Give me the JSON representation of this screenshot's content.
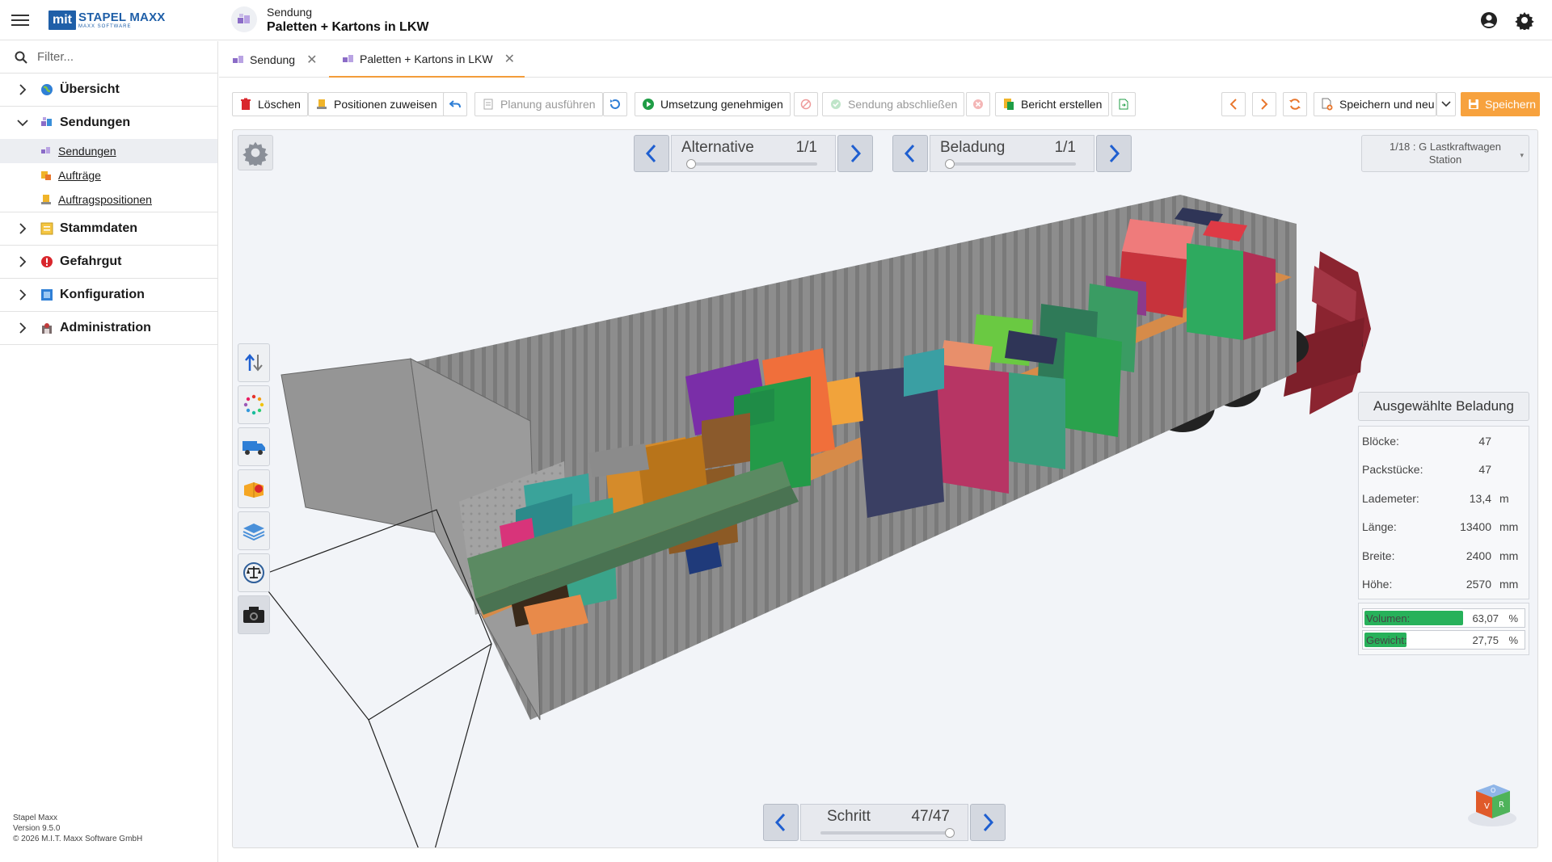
{
  "app": {
    "logo_mark": "mit",
    "logo_name": "STAPEL MAXX",
    "logo_sub": "MAXX SOFTWARE"
  },
  "header": {
    "subtitle": "Sendung",
    "title": "Paletten + Kartons in LKW",
    "icons": [
      "hamburger-icon",
      "account-icon",
      "settings-icon"
    ]
  },
  "sidebar": {
    "filter_placeholder": "Filter...",
    "items": [
      {
        "label": "Übersicht",
        "icon": "globe-icon"
      },
      {
        "label": "Sendungen",
        "icon": "shipment-icon",
        "expanded": true,
        "children": [
          {
            "label": "Sendungen",
            "icon": "shipment-icon",
            "active": true
          },
          {
            "label": "Aufträge",
            "icon": "orders-icon"
          },
          {
            "label": "Auftragspositionen",
            "icon": "order-positions-icon"
          }
        ]
      },
      {
        "label": "Stammdaten",
        "icon": "master-data-icon"
      },
      {
        "label": "Gefahrgut",
        "icon": "hazard-icon"
      },
      {
        "label": "Konfiguration",
        "icon": "config-icon"
      },
      {
        "label": "Administration",
        "icon": "admin-icon"
      }
    ],
    "footer": {
      "line1": "Stapel Maxx",
      "line2": "Version 9.5.0",
      "line3": "© 2026 M.I.T. Maxx Software GmbH"
    }
  },
  "tabs": [
    {
      "label": "Sendung",
      "active": false
    },
    {
      "label": "Paletten + Kartons in LKW",
      "active": true
    }
  ],
  "toolbar": {
    "delete": "Löschen",
    "assign_positions": "Positionen zuweisen",
    "run_planning": "Planung ausführen",
    "approve": "Umsetzung genehmigen",
    "close_shipment": "Sendung abschließen",
    "create_report": "Bericht erstellen",
    "save_and_new": "Speichern und neu",
    "save": "Speichern"
  },
  "viewer": {
    "alternative": {
      "label": "Alternative",
      "value": "1/1",
      "progress": 0.0
    },
    "loading": {
      "label": "Beladung",
      "value": "1/1",
      "progress": 0.0
    },
    "vehicle": {
      "line1": "1/18 : G Lastkraftwagen",
      "line2": "Station"
    },
    "step": {
      "label": "Schritt",
      "value": "47/47",
      "progress": 1.0
    },
    "side_tools": [
      "sort-arrows-icon",
      "color-dots-icon",
      "truck-icon",
      "box-icon",
      "pallet-layers-icon",
      "scale-icon",
      "camera-icon"
    ]
  },
  "selected_loading": {
    "title": "Ausgewählte Beladung",
    "rows": [
      {
        "label": "Blöcke:",
        "value": "47",
        "unit": ""
      },
      {
        "label": "Packstücke:",
        "value": "47",
        "unit": ""
      },
      {
        "label": "Lademeter:",
        "value": "13,4",
        "unit": "m"
      },
      {
        "label": "Länge:",
        "value": "13400",
        "unit": "mm"
      },
      {
        "label": "Breite:",
        "value": "2400",
        "unit": "mm"
      },
      {
        "label": "Höhe:",
        "value": "2570",
        "unit": "mm"
      }
    ],
    "volume": {
      "label": "Volumen:",
      "value": "63,07",
      "unit": "%",
      "fraction": 0.6307
    },
    "weight": {
      "label": "Gewicht:",
      "value": "27,75",
      "unit": "%",
      "fraction": 0.2775
    }
  },
  "colors": {
    "accent_orange": "#f7a23e",
    "brand_blue": "#1f5fa8",
    "progress_green": "#27b15a"
  }
}
